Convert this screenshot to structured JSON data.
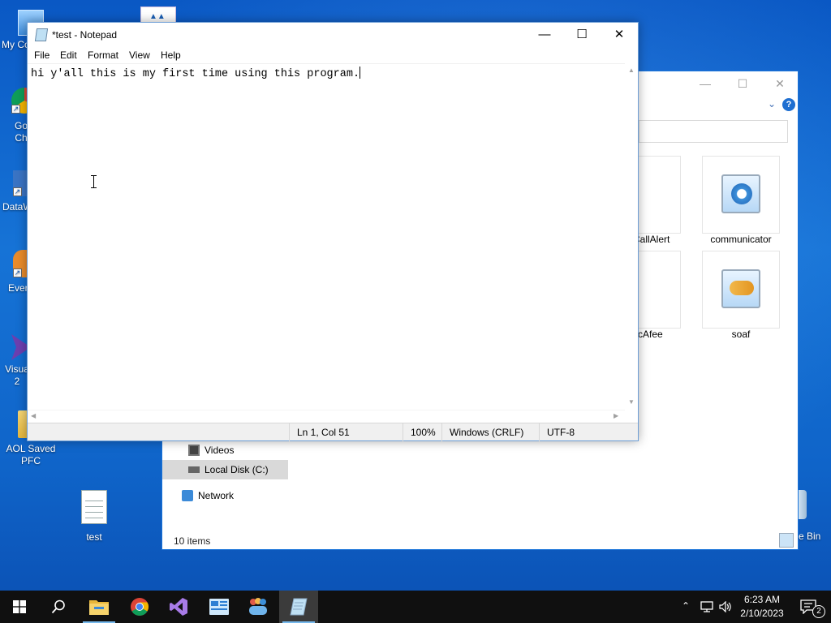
{
  "desktop": {
    "icons": [
      {
        "label": "My Co"
      },
      {
        "label": "Go Ch"
      },
      {
        "label": "DataW"
      },
      {
        "label": "Ever"
      },
      {
        "label": "Visua 2"
      },
      {
        "label": "AOL Saved PFC"
      },
      {
        "label": "test"
      },
      {
        "label": "e Bin"
      }
    ]
  },
  "explorer": {
    "tiles": [
      {
        "label": "CallAlert"
      },
      {
        "label": "communicator"
      },
      {
        "label": "cAfee"
      },
      {
        "label": "soaf"
      }
    ],
    "nav": [
      {
        "label": "Videos"
      },
      {
        "label": "Local Disk (C:)"
      },
      {
        "label": "Network"
      }
    ],
    "status": "10 items"
  },
  "notepad": {
    "title": "*test - Notepad",
    "menu": [
      "File",
      "Edit",
      "Format",
      "View",
      "Help"
    ],
    "content": "hi y'all this is my first time using this program.",
    "status": {
      "position": "Ln 1, Col 51",
      "zoom": "100%",
      "line_ending": "Windows (CRLF)",
      "encoding": "UTF-8"
    }
  },
  "taskbar": {
    "apps": [
      {
        "icon": "windows-start-icon"
      },
      {
        "icon": "search-icon"
      },
      {
        "icon": "file-explorer-icon"
      },
      {
        "icon": "chrome-icon"
      },
      {
        "icon": "visual-studio-icon"
      },
      {
        "icon": "contacts-app-icon"
      },
      {
        "icon": "people-app-icon"
      },
      {
        "icon": "notepad-icon"
      }
    ],
    "clock": {
      "time": "6:23 AM",
      "date": "2/10/2023"
    },
    "notification_count": "2"
  },
  "colors": {
    "taskbar": "#101010",
    "accent": "#76b9ed",
    "window_border": "#6d9ed6"
  }
}
